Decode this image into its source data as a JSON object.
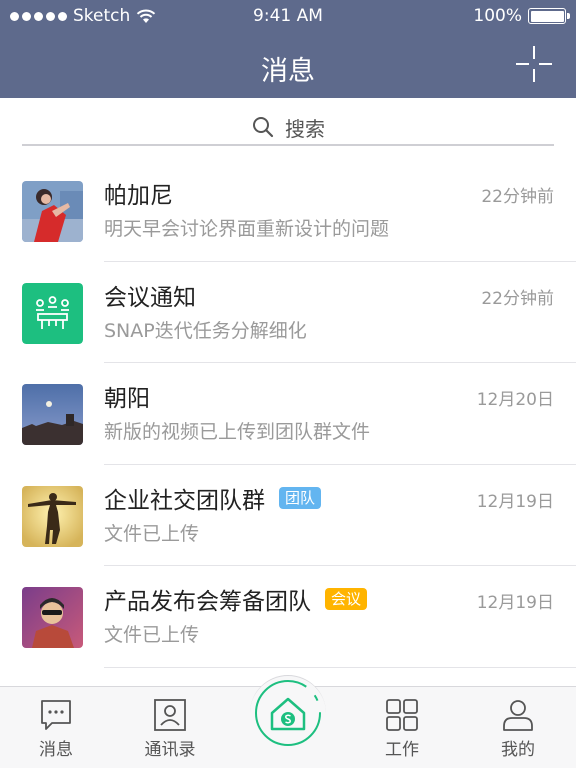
{
  "status_bar": {
    "carrier": "Sketch",
    "time": "9:41 AM",
    "battery": "100%",
    "battery_level": 1.0
  },
  "nav": {
    "title": "消息",
    "add_icon": "plus-icon"
  },
  "search": {
    "placeholder": "搜索",
    "icon": "search-icon"
  },
  "conversations": [
    {
      "name": "帕加尼",
      "preview": "明天早会讨论界面重新设计的问题",
      "time": "22分钟前",
      "tag": "",
      "avatar": "photo-woman-red"
    },
    {
      "name": "会议通知",
      "preview": "SNAP迭代任务分解细化",
      "time": "22分钟前",
      "tag": "",
      "avatar": "meeting-icon"
    },
    {
      "name": "朝阳",
      "preview": "新版的视频已上传到团队群文件",
      "time": "12月20日",
      "tag": "",
      "avatar": "photo-evening-sky"
    },
    {
      "name": "企业社交团队群",
      "preview": "文件已上传",
      "time": "12月19日",
      "tag": "团队",
      "tag_color": "#63b5f0",
      "avatar": "photo-figure-yellow"
    },
    {
      "name": "产品发布会筹备团队",
      "preview": "文件已上传",
      "time": "12月19日",
      "tag": "会议",
      "tag_color": "#ffb400",
      "avatar": "photo-man-purple"
    }
  ],
  "tabs": [
    {
      "label": "消息",
      "icon": "chat-icon"
    },
    {
      "label": "通讯录",
      "icon": "contacts-icon"
    },
    {
      "label": "",
      "icon": "home-logo-icon"
    },
    {
      "label": "工作",
      "icon": "grid-icon"
    },
    {
      "label": "我的",
      "icon": "person-icon"
    }
  ],
  "colors": {
    "header": "#5e6a8c",
    "accent_green": "#1dbf80",
    "tag_blue": "#63b5f0",
    "tag_orange": "#ffb400"
  }
}
